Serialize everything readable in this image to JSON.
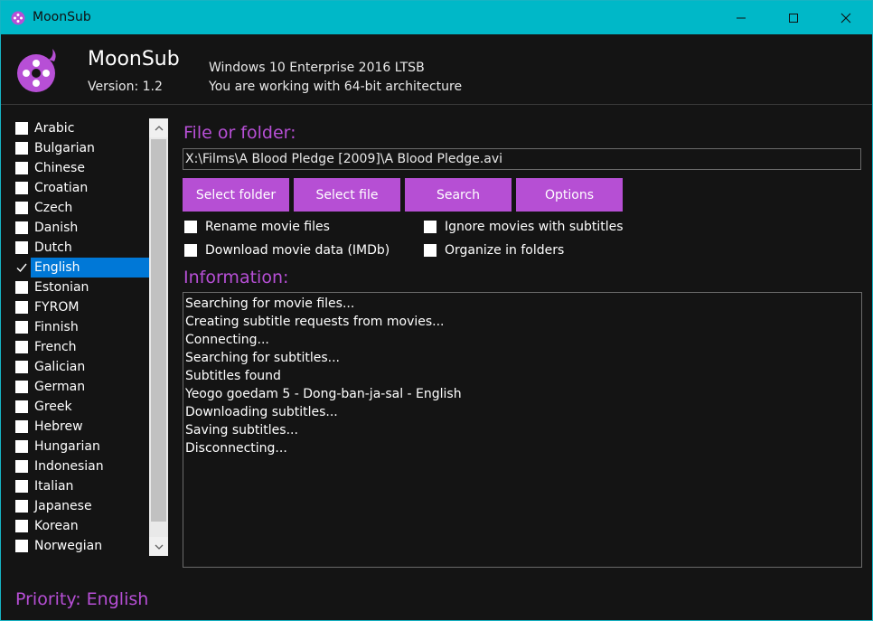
{
  "window": {
    "title": "MoonSub",
    "icon": "moonsub-app-icon",
    "controls": [
      "minimize-icon",
      "maximize-icon",
      "close-icon"
    ],
    "accent_color": "#00b8c8"
  },
  "header": {
    "app_name": "MoonSub",
    "version": "Version: 1.2",
    "os": "Windows 10 Enterprise 2016 LTSB",
    "architecture": "You are working with 64-bit architecture"
  },
  "languages": {
    "items": [
      {
        "label": "Arabic",
        "checked": false
      },
      {
        "label": "Bulgarian",
        "checked": false
      },
      {
        "label": "Chinese",
        "checked": false
      },
      {
        "label": "Croatian",
        "checked": false
      },
      {
        "label": "Czech",
        "checked": false
      },
      {
        "label": "Danish",
        "checked": false
      },
      {
        "label": "Dutch",
        "checked": false
      },
      {
        "label": "English",
        "checked": true,
        "selected": true
      },
      {
        "label": "Estonian",
        "checked": false
      },
      {
        "label": "FYROM",
        "checked": false
      },
      {
        "label": "Finnish",
        "checked": false
      },
      {
        "label": "French",
        "checked": false
      },
      {
        "label": "Galician",
        "checked": false
      },
      {
        "label": "German",
        "checked": false
      },
      {
        "label": "Greek",
        "checked": false
      },
      {
        "label": "Hebrew",
        "checked": false
      },
      {
        "label": "Hungarian",
        "checked": false
      },
      {
        "label": "Indonesian",
        "checked": false
      },
      {
        "label": "Italian",
        "checked": false
      },
      {
        "label": "Japanese",
        "checked": false
      },
      {
        "label": "Korean",
        "checked": false
      },
      {
        "label": "Norwegian",
        "checked": false
      }
    ]
  },
  "file": {
    "label": "File or folder:",
    "path": "X:\\Films\\A Blood Pledge [2009]\\A Blood Pledge.avi"
  },
  "buttons": {
    "select_folder": "Select folder",
    "select_file": "Select file",
    "search": "Search",
    "options": "Options"
  },
  "options": {
    "rename": {
      "label": "Rename movie files",
      "checked": false
    },
    "imdb": {
      "label": "Download movie data (IMDb)",
      "checked": false
    },
    "ignore": {
      "label": "Ignore movies with subtitles",
      "checked": false
    },
    "organize": {
      "label": "Organize in folders",
      "checked": false
    }
  },
  "information": {
    "label": "Information:",
    "lines": [
      "Searching for movie files...",
      "Creating subtitle requests from movies...",
      "Connecting...",
      "Searching for subtitles...",
      "Subtitles found",
      "Yeogo goedam 5 - Dong-ban-ja-sal - English",
      "Downloading subtitles...",
      "Saving subtitles...",
      "Disconnecting..."
    ]
  },
  "priority": "Priority: English",
  "colors": {
    "purple": "#b74fd6",
    "selection": "#0078d7",
    "background": "#141414"
  }
}
